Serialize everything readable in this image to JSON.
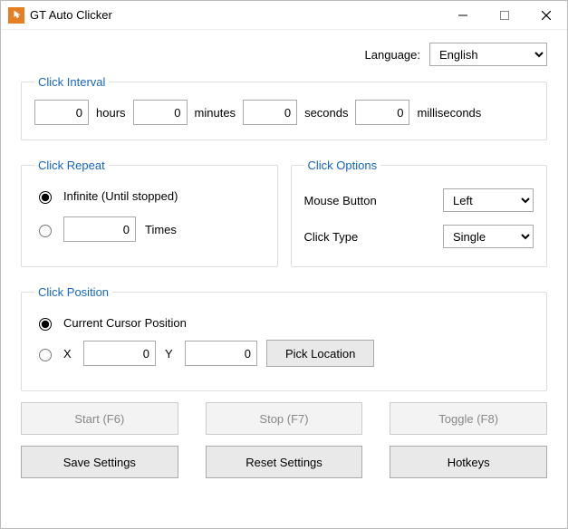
{
  "window": {
    "title": "GT Auto Clicker"
  },
  "language": {
    "label": "Language:",
    "selected": "English"
  },
  "interval": {
    "legend": "Click Interval",
    "hours": "0",
    "hours_label": "hours",
    "minutes": "0",
    "minutes_label": "minutes",
    "seconds": "0",
    "seconds_label": "seconds",
    "ms": "0",
    "ms_label": "milliseconds"
  },
  "repeat": {
    "legend": "Click Repeat",
    "infinite_label": "Infinite (Until stopped)",
    "times_value": "0",
    "times_label": "Times"
  },
  "options": {
    "legend": "Click Options",
    "mouse_button_label": "Mouse Button",
    "mouse_button_value": "Left",
    "click_type_label": "Click Type",
    "click_type_value": "Single"
  },
  "position": {
    "legend": "Click Position",
    "current_label": "Current Cursor Position",
    "x_label": "X",
    "x_value": "0",
    "y_label": "Y",
    "y_value": "0",
    "pick_label": "Pick Location"
  },
  "actions": {
    "start": "Start (F6)",
    "stop": "Stop (F7)",
    "toggle": "Toggle (F8)",
    "save": "Save Settings",
    "reset": "Reset Settings",
    "hotkeys": "Hotkeys"
  }
}
